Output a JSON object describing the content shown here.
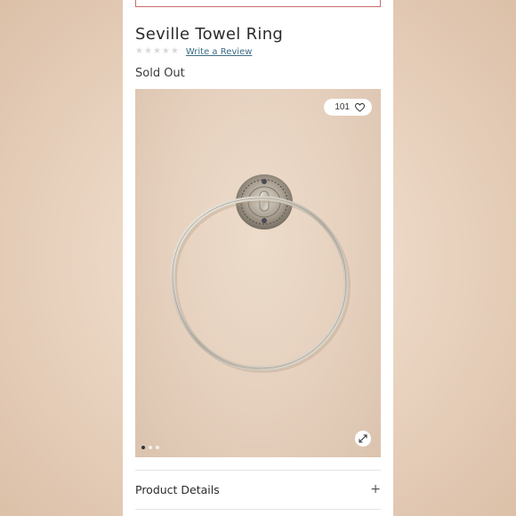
{
  "product": {
    "title": "Seville Towel Ring",
    "rating_stars": 5,
    "review_link": "Write a Review",
    "status": "Sold Out"
  },
  "gallery": {
    "favorites_count": "101",
    "slide_count": 3,
    "active_slide": 1,
    "favorite_icon": "heart-outline-icon",
    "zoom_icon": "expand-icon"
  },
  "accordion": {
    "details_label": "Product Details",
    "toggle_symbol": "+"
  },
  "colors": {
    "link": "#3c6e86",
    "top_border": "#c96a6a",
    "stars_empty": "#d9d9d9"
  }
}
